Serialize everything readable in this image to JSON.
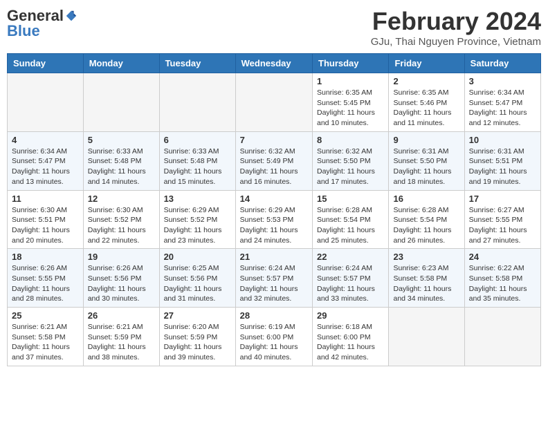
{
  "header": {
    "logo_general": "General",
    "logo_blue": "Blue",
    "month_title": "February 2024",
    "subtitle": "GJu, Thai Nguyen Province, Vietnam"
  },
  "days_of_week": [
    "Sunday",
    "Monday",
    "Tuesday",
    "Wednesday",
    "Thursday",
    "Friday",
    "Saturday"
  ],
  "weeks": [
    [
      {
        "day": "",
        "info": ""
      },
      {
        "day": "",
        "info": ""
      },
      {
        "day": "",
        "info": ""
      },
      {
        "day": "",
        "info": ""
      },
      {
        "day": "1",
        "info": "Sunrise: 6:35 AM\nSunset: 5:45 PM\nDaylight: 11 hours and 10 minutes."
      },
      {
        "day": "2",
        "info": "Sunrise: 6:35 AM\nSunset: 5:46 PM\nDaylight: 11 hours and 11 minutes."
      },
      {
        "day": "3",
        "info": "Sunrise: 6:34 AM\nSunset: 5:47 PM\nDaylight: 11 hours and 12 minutes."
      }
    ],
    [
      {
        "day": "4",
        "info": "Sunrise: 6:34 AM\nSunset: 5:47 PM\nDaylight: 11 hours and 13 minutes."
      },
      {
        "day": "5",
        "info": "Sunrise: 6:33 AM\nSunset: 5:48 PM\nDaylight: 11 hours and 14 minutes."
      },
      {
        "day": "6",
        "info": "Sunrise: 6:33 AM\nSunset: 5:48 PM\nDaylight: 11 hours and 15 minutes."
      },
      {
        "day": "7",
        "info": "Sunrise: 6:32 AM\nSunset: 5:49 PM\nDaylight: 11 hours and 16 minutes."
      },
      {
        "day": "8",
        "info": "Sunrise: 6:32 AM\nSunset: 5:50 PM\nDaylight: 11 hours and 17 minutes."
      },
      {
        "day": "9",
        "info": "Sunrise: 6:31 AM\nSunset: 5:50 PM\nDaylight: 11 hours and 18 minutes."
      },
      {
        "day": "10",
        "info": "Sunrise: 6:31 AM\nSunset: 5:51 PM\nDaylight: 11 hours and 19 minutes."
      }
    ],
    [
      {
        "day": "11",
        "info": "Sunrise: 6:30 AM\nSunset: 5:51 PM\nDaylight: 11 hours and 20 minutes."
      },
      {
        "day": "12",
        "info": "Sunrise: 6:30 AM\nSunset: 5:52 PM\nDaylight: 11 hours and 22 minutes."
      },
      {
        "day": "13",
        "info": "Sunrise: 6:29 AM\nSunset: 5:52 PM\nDaylight: 11 hours and 23 minutes."
      },
      {
        "day": "14",
        "info": "Sunrise: 6:29 AM\nSunset: 5:53 PM\nDaylight: 11 hours and 24 minutes."
      },
      {
        "day": "15",
        "info": "Sunrise: 6:28 AM\nSunset: 5:54 PM\nDaylight: 11 hours and 25 minutes."
      },
      {
        "day": "16",
        "info": "Sunrise: 6:28 AM\nSunset: 5:54 PM\nDaylight: 11 hours and 26 minutes."
      },
      {
        "day": "17",
        "info": "Sunrise: 6:27 AM\nSunset: 5:55 PM\nDaylight: 11 hours and 27 minutes."
      }
    ],
    [
      {
        "day": "18",
        "info": "Sunrise: 6:26 AM\nSunset: 5:55 PM\nDaylight: 11 hours and 28 minutes."
      },
      {
        "day": "19",
        "info": "Sunrise: 6:26 AM\nSunset: 5:56 PM\nDaylight: 11 hours and 30 minutes."
      },
      {
        "day": "20",
        "info": "Sunrise: 6:25 AM\nSunset: 5:56 PM\nDaylight: 11 hours and 31 minutes."
      },
      {
        "day": "21",
        "info": "Sunrise: 6:24 AM\nSunset: 5:57 PM\nDaylight: 11 hours and 32 minutes."
      },
      {
        "day": "22",
        "info": "Sunrise: 6:24 AM\nSunset: 5:57 PM\nDaylight: 11 hours and 33 minutes."
      },
      {
        "day": "23",
        "info": "Sunrise: 6:23 AM\nSunset: 5:58 PM\nDaylight: 11 hours and 34 minutes."
      },
      {
        "day": "24",
        "info": "Sunrise: 6:22 AM\nSunset: 5:58 PM\nDaylight: 11 hours and 35 minutes."
      }
    ],
    [
      {
        "day": "25",
        "info": "Sunrise: 6:21 AM\nSunset: 5:58 PM\nDaylight: 11 hours and 37 minutes."
      },
      {
        "day": "26",
        "info": "Sunrise: 6:21 AM\nSunset: 5:59 PM\nDaylight: 11 hours and 38 minutes."
      },
      {
        "day": "27",
        "info": "Sunrise: 6:20 AM\nSunset: 5:59 PM\nDaylight: 11 hours and 39 minutes."
      },
      {
        "day": "28",
        "info": "Sunrise: 6:19 AM\nSunset: 6:00 PM\nDaylight: 11 hours and 40 minutes."
      },
      {
        "day": "29",
        "info": "Sunrise: 6:18 AM\nSunset: 6:00 PM\nDaylight: 11 hours and 42 minutes."
      },
      {
        "day": "",
        "info": ""
      },
      {
        "day": "",
        "info": ""
      }
    ]
  ]
}
